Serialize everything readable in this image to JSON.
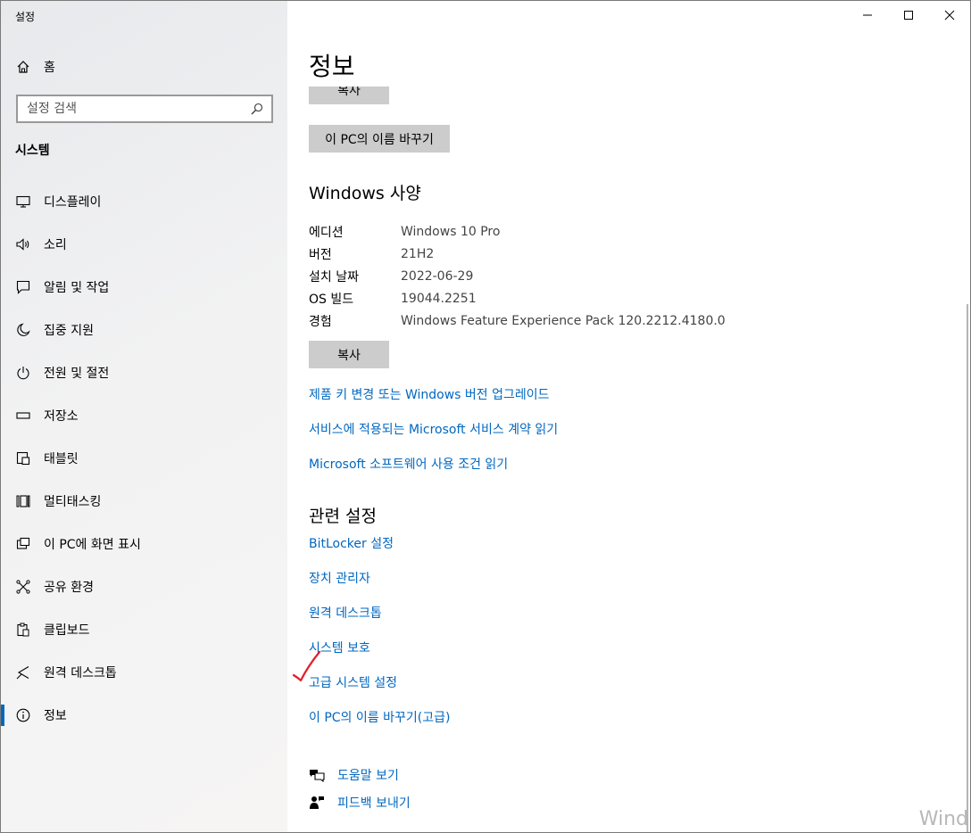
{
  "window": {
    "title": "설정"
  },
  "sidebar": {
    "home_label": "홈",
    "search_placeholder": "설정 검색",
    "section_title": "시스템",
    "items": [
      {
        "label": "디스플레이",
        "icon": "monitor-icon"
      },
      {
        "label": "소리",
        "icon": "speaker-icon"
      },
      {
        "label": "알림 및 작업",
        "icon": "notification-icon"
      },
      {
        "label": "집중 지원",
        "icon": "moon-icon"
      },
      {
        "label": "전원 및 절전",
        "icon": "power-icon"
      },
      {
        "label": "저장소",
        "icon": "storage-icon"
      },
      {
        "label": "태블릿",
        "icon": "tablet-icon"
      },
      {
        "label": "멀티태스킹",
        "icon": "multitasking-icon"
      },
      {
        "label": "이 PC에 화면 표시",
        "icon": "project-icon"
      },
      {
        "label": "공유 환경",
        "icon": "share-icon"
      },
      {
        "label": "클립보드",
        "icon": "clipboard-icon"
      },
      {
        "label": "원격 데스크톱",
        "icon": "remote-icon"
      },
      {
        "label": "정보",
        "icon": "info-icon",
        "active": true
      }
    ]
  },
  "main": {
    "page_title": "정보",
    "copy_top_label": "복사",
    "rename_pc_label": "이 PC의 이름 바꾸기",
    "windows_spec_title": "Windows 사양",
    "spec_rows": [
      {
        "key": "에디션",
        "value": "Windows 10 Pro"
      },
      {
        "key": "버전",
        "value": "21H2"
      },
      {
        "key": "설치 날짜",
        "value": "2022-06-29"
      },
      {
        "key": "OS 빌드",
        "value": "19044.2251"
      },
      {
        "key": "경험",
        "value": "Windows Feature Experience Pack 120.2212.4180.0"
      }
    ],
    "copy_label": "복사",
    "links": [
      "제품 키 변경 또는 Windows 버전 업그레이드",
      "서비스에 적용되는 Microsoft 서비스 계약 읽기",
      "Microsoft 소프트웨어 사용 조건 읽기"
    ],
    "related_title": "관련 설정",
    "related_links": [
      "BitLocker 설정",
      "장치 관리자",
      "원격 데스크톱",
      "시스템 보호",
      "고급 시스템 설정",
      "이 PC의 이름 바꾸기(고급)"
    ],
    "help_label": "도움말 보기",
    "feedback_label": "피드백 보내기"
  },
  "watermark": "Wind",
  "accent_color": "#0067c0",
  "annotation_color": "#e0202a"
}
